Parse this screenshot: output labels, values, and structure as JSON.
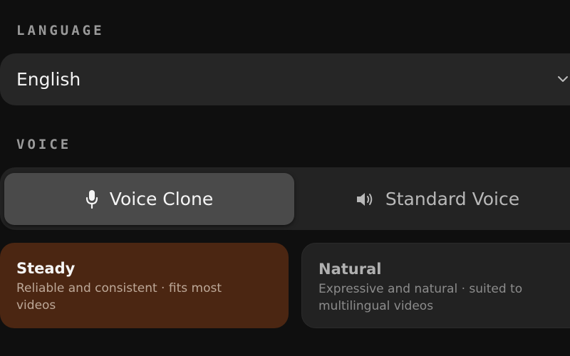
{
  "language": {
    "section_label": "LANGUAGE",
    "selected": "English",
    "chevron_icon": "chevron-down-icon"
  },
  "voice": {
    "section_label": "VOICE",
    "options": [
      {
        "label": "Voice Clone",
        "icon": "microphone-icon",
        "selected": true
      },
      {
        "label": "Standard Voice",
        "icon": "speaker-icon",
        "selected": false
      }
    ]
  },
  "styles": [
    {
      "title": "Steady",
      "description": "Reliable and consistent · fits most videos",
      "selected": true
    },
    {
      "title": "Natural",
      "description": "Expressive and natural · suited to multilingual videos",
      "selected": false
    }
  ],
  "colors": {
    "background": "#0f0f0f",
    "selected_card": "#4b2612",
    "segment_active": "#4a4a4a"
  }
}
